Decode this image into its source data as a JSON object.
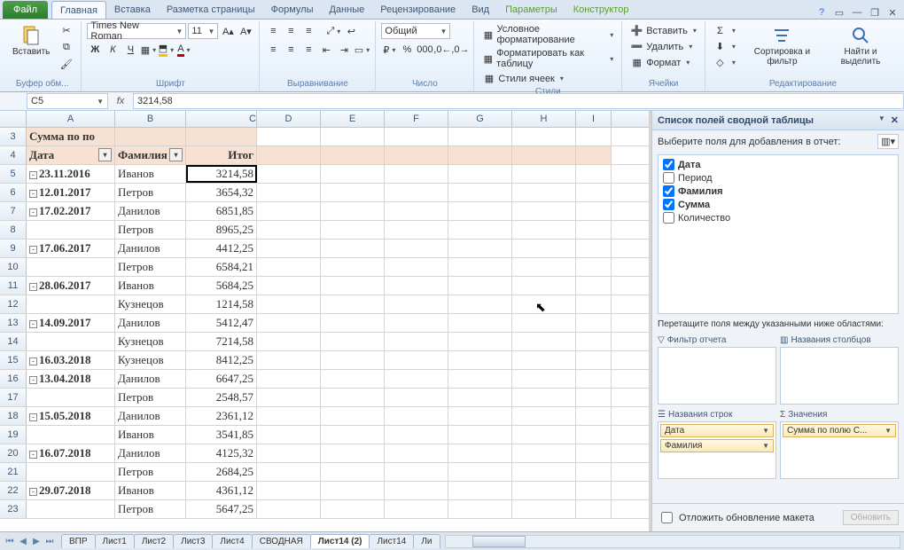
{
  "tabs": {
    "file": "Файл",
    "home": "Главная",
    "insert": "Вставка",
    "page": "Разметка страницы",
    "formulas": "Формулы",
    "data": "Данные",
    "review": "Рецензирование",
    "view": "Вид",
    "options": "Параметры",
    "design": "Конструктор"
  },
  "ribbon": {
    "paste": "Вставить",
    "font_name": "Times New Roman",
    "font_size": "11",
    "number_format": "Общий",
    "cond_fmt": "Условное форматирование",
    "fmt_table": "Форматировать как таблицу",
    "cell_styles": "Стили ячеек",
    "insert_cells": "Вставить",
    "delete_cells": "Удалить",
    "format_cells": "Формат",
    "sort_filter": "Сортировка и фильтр",
    "find_select": "Найти и выделить",
    "groups": {
      "clipboard": "Буфер обм...",
      "font": "Шрифт",
      "align": "Выравнивание",
      "number": "Число",
      "styles": "Стили",
      "cells": "Ячейки",
      "editing": "Редактирование"
    }
  },
  "namebox": "C5",
  "formula": "3214,58",
  "columns": [
    "A",
    "B",
    "C",
    "D",
    "E",
    "F",
    "G",
    "H",
    "I"
  ],
  "header0": "Сумма по по",
  "headers": {
    "A": "Дата",
    "B": "Фамилия",
    "C": "Итог"
  },
  "rows": [
    {
      "n": 3,
      "A_hdr": true
    },
    {
      "n": 4,
      "hdr": true
    },
    {
      "n": 5,
      "exp": "-",
      "A": "23.11.2016",
      "B": "Иванов",
      "C": "3214,58",
      "active": true
    },
    {
      "n": 6,
      "exp": "-",
      "A": "12.01.2017",
      "B": "Петров",
      "C": "3654,32"
    },
    {
      "n": 7,
      "exp": "-",
      "A": "17.02.2017",
      "B": "Данилов",
      "C": "6851,85"
    },
    {
      "n": 8,
      "B": "Петров",
      "C": "8965,25"
    },
    {
      "n": 9,
      "exp": "-",
      "A": "17.06.2017",
      "B": "Данилов",
      "C": "4412,25"
    },
    {
      "n": 10,
      "B": "Петров",
      "C": "6584,21"
    },
    {
      "n": 11,
      "exp": "-",
      "A": "28.06.2017",
      "B": "Иванов",
      "C": "5684,25"
    },
    {
      "n": 12,
      "B": "Кузнецов",
      "C": "1214,58"
    },
    {
      "n": 13,
      "exp": "-",
      "A": "14.09.2017",
      "B": "Данилов",
      "C": "5412,47"
    },
    {
      "n": 14,
      "B": "Кузнецов",
      "C": "7214,58"
    },
    {
      "n": 15,
      "exp": "-",
      "A": "16.03.2018",
      "B": "Кузнецов",
      "C": "8412,25"
    },
    {
      "n": 16,
      "exp": "-",
      "A": "13.04.2018",
      "B": "Данилов",
      "C": "6647,25"
    },
    {
      "n": 17,
      "B": "Петров",
      "C": "2548,57"
    },
    {
      "n": 18,
      "exp": "-",
      "A": "15.05.2018",
      "B": "Данилов",
      "C": "2361,12"
    },
    {
      "n": 19,
      "B": "Иванов",
      "C": "3541,85"
    },
    {
      "n": 20,
      "exp": "-",
      "A": "16.07.2018",
      "B": "Данилов",
      "C": "4125,32"
    },
    {
      "n": 21,
      "B": "Петров",
      "C": "2684,25"
    },
    {
      "n": 22,
      "exp": "-",
      "A": "29.07.2018",
      "B": "Иванов",
      "C": "4361,12"
    },
    {
      "n": 23,
      "B": "Петров",
      "C": "5647,25"
    }
  ],
  "pane": {
    "title": "Список полей сводной таблицы",
    "choose": "Выберите поля для добавления в отчет:",
    "fields": [
      {
        "label": "Дата",
        "checked": true,
        "bold": true
      },
      {
        "label": "Период",
        "checked": false,
        "bold": false
      },
      {
        "label": "Фамилия",
        "checked": true,
        "bold": true
      },
      {
        "label": "Сумма",
        "checked": true,
        "bold": true
      },
      {
        "label": "Количество",
        "checked": false,
        "bold": false
      }
    ],
    "drag": "Перетащите поля между указанными ниже областями:",
    "area_filter": "Фильтр отчета",
    "area_cols": "Названия столбцов",
    "area_rows": "Названия строк",
    "area_vals": "Значения",
    "row_items": [
      "Дата",
      "Фамилия"
    ],
    "val_items": [
      "Сумма по полю С..."
    ],
    "defer": "Отложить обновление макета",
    "update": "Обновить"
  },
  "sheets": [
    "ВПР",
    "Лист1",
    "Лист2",
    "Лист3",
    "Лист4",
    "СВОДНАЯ",
    "Лист14 (2)",
    "Лист14",
    "Ли"
  ],
  "active_sheet": "Лист14 (2)"
}
